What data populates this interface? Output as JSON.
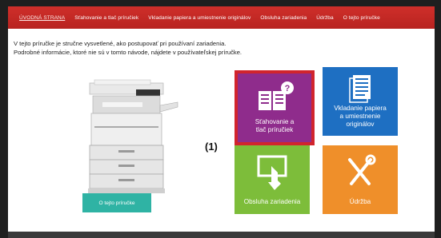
{
  "nav": {
    "items": [
      {
        "label": "ÚVODNÁ STRANA",
        "active": true
      },
      {
        "label": "Sťahovanie a tlač príručiek",
        "active": false
      },
      {
        "label": "Vkladanie papiera a umiestnenie originálov",
        "active": false
      },
      {
        "label": "Obsluha zariadenia",
        "active": false
      },
      {
        "label": "Údržba",
        "active": false
      },
      {
        "label": "O tejto príručke",
        "active": false
      }
    ]
  },
  "intro": {
    "line1": "V tejto príručke je stručne vysvetlené, ako postupovať pri používaní zariadenia.",
    "line2": "Podrobné informácie, ktoré nie sú v tomto návode, nájdete v používateľskej príručke."
  },
  "about_button": "O tejto príručke",
  "tiles": {
    "manual": {
      "label1": "Sťahovanie a",
      "label2": "tlač príručiek",
      "icon": "manual-download-icon"
    },
    "paper": {
      "label1": "Vkladanie papiera",
      "label2": "a umiestnenie",
      "label3": "originálov",
      "icon": "document-icon"
    },
    "operate": {
      "label": "Obsluha zariadenia",
      "icon": "touch-screen-icon"
    },
    "maint": {
      "label": "Údržba",
      "icon": "tools-icon"
    }
  },
  "callout": "(1)",
  "colors": {
    "navbar": "#c62a26",
    "tile_manual": "#8f2c8c",
    "tile_manual_border": "#d1242d",
    "tile_paper": "#1e6fc2",
    "tile_operate": "#7dbd3a",
    "tile_maint": "#ef8f2a",
    "about_button": "#2fb3a4"
  }
}
